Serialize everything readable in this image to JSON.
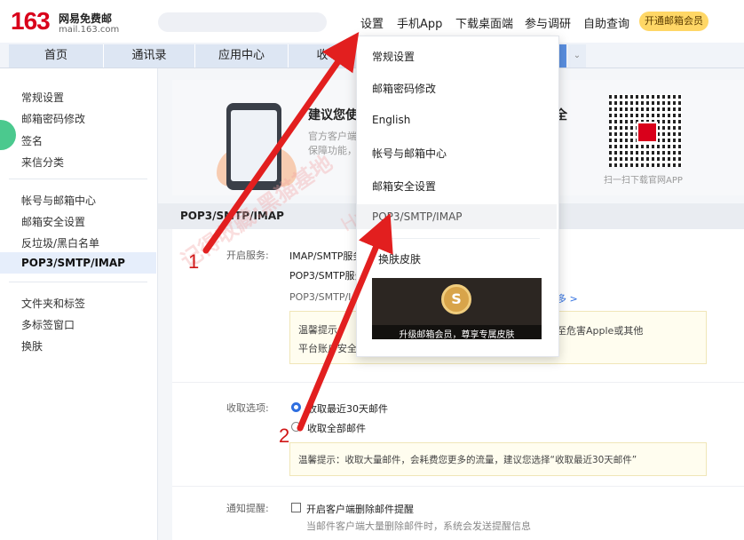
{
  "brand": {
    "number": "163",
    "name": "网易免费邮",
    "domain": "mail.163.com"
  },
  "toplinks": [
    "设置",
    "手机App",
    "下载桌面端",
    "参与调研",
    "自助查询"
  ],
  "vip_button": "开通邮箱会员",
  "tabs": [
    "首页",
    "通讯录",
    "应用中心",
    "收"
  ],
  "sidebar": {
    "group1": [
      "常规设置",
      "邮箱密码修改",
      "签名",
      "来信分类"
    ],
    "group2": [
      "帐号与邮箱中心",
      "邮箱安全设置",
      "反垃圾/黑白名单",
      "POP3/SMTP/IMAP"
    ],
    "group3": [
      "文件夹和标签",
      "多标签窗口",
      "换肤"
    ]
  },
  "promo": {
    "title": "建议您使",
    "title_end": "全",
    "line1": "官方客户端",
    "line2": "保障功能，",
    "qr_caption": "扫一扫下载官网APP"
  },
  "section": {
    "title": "POP3/SMTP/IMAP"
  },
  "service": {
    "label": "开启服务:",
    "imap": "IMAP/SMTP服务",
    "pop3": "POP3/SMTP服务",
    "pop3_short": "POP3/SMTP/I",
    "more": "多 >",
    "note_line1_start": "温馨提示：",
    "note_line1_end": "至危害Apple或其他",
    "note_line2": "平台账户安全"
  },
  "receive": {
    "label": "收取选项:",
    "option1": "收取最近30天邮件",
    "option2": "收取全部邮件",
    "note": "温馨提示：收取大量邮件，会耗费您更多的流量，建议您选择“收取最近30天邮件”"
  },
  "notify": {
    "label": "通知提醒:",
    "checkbox": "开启客户端删除邮件提醒",
    "desc": "当邮件客户端大量删除邮件时，系统会发送提醒信息"
  },
  "menu": {
    "items": [
      "常规设置",
      "邮箱密码修改",
      "English",
      "帐号与邮箱中心",
      "邮箱安全设置",
      "POP3/SMTP/IMAP"
    ],
    "skin": "换肤皮肤",
    "banner_text": "升级邮箱会员，尊享专属皮肤"
  },
  "annotations": {
    "step1": "1",
    "step2": "2"
  },
  "watermark": {
    "text1": "记得收藏:黑猫基地",
    "text2": "Hybase.com"
  },
  "colors": {
    "accent": "#2f6fe0",
    "brand_red": "#d9001b",
    "arrow": "#e21f1f",
    "vip": "#ffd766"
  }
}
